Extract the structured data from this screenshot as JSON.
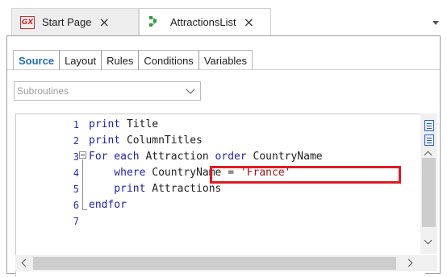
{
  "tabs": [
    {
      "label": "Start Page",
      "icon": "genexus-logo-icon",
      "close": "×"
    },
    {
      "label": "AttractionsList",
      "icon": "procedure-icon",
      "close": "×"
    }
  ],
  "subtabs": [
    "Source",
    "Layout",
    "Rules",
    "Conditions",
    "Variables"
  ],
  "active_subtab": "Source",
  "subroutines_combo": {
    "placeholder": "Subroutines"
  },
  "code": {
    "line_numbers": [
      "1",
      "2",
      "3",
      "4",
      "5",
      "6",
      "7"
    ],
    "lines": [
      {
        "segments": [
          {
            "t": "print",
            "k": "kw"
          },
          {
            "t": " Title",
            "k": ""
          }
        ]
      },
      {
        "segments": [
          {
            "t": "print",
            "k": "kw"
          },
          {
            "t": " ColumnTitles",
            "k": ""
          }
        ]
      },
      {
        "segments": [
          {
            "t": "For each",
            "k": "kw"
          },
          {
            "t": " Attraction ",
            "k": ""
          },
          {
            "t": "order",
            "k": "kw"
          },
          {
            "t": " CountryName",
            "k": ""
          }
        ]
      },
      {
        "segments": [
          {
            "t": "    where",
            "k": "kw"
          },
          {
            "t": " CountryName = ",
            "k": ""
          },
          {
            "t": "'France'",
            "k": "str"
          }
        ]
      },
      {
        "segments": [
          {
            "t": "    print",
            "k": "kw"
          },
          {
            "t": " Attractions",
            "k": ""
          }
        ]
      },
      {
        "segments": [
          {
            "t": "endfor",
            "k": "kw"
          }
        ]
      },
      {
        "segments": []
      }
    ]
  },
  "colors": {
    "accent": "#1f6cc2",
    "keyword": "#1f1fb0",
    "string": "#a31515",
    "highlight_border": "#e01a22"
  }
}
